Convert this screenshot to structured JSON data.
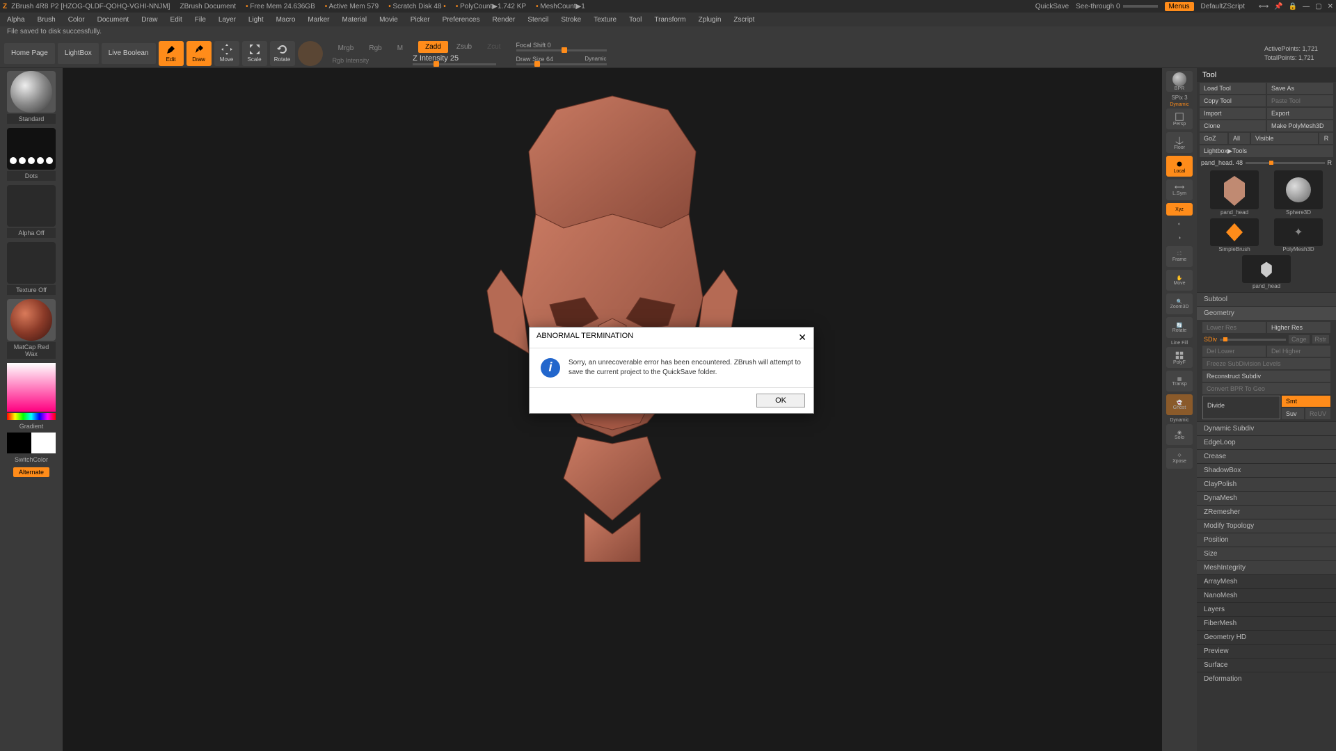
{
  "titlebar": {
    "app": "ZBrush 4R8 P2 [HZOG-QLDF-QOHQ-VGHI-NNJM]",
    "doc": "ZBrush Document",
    "freemem": "Free Mem 24.636GB",
    "activemem": "Active Mem 579",
    "scratch": "Scratch Disk 48",
    "polycount": "PolyCount▶1.742 KP",
    "meshcount": "MeshCount▶1",
    "quicksave": "QuickSave",
    "seethrough": "See-through  0",
    "menus": "Menus",
    "defaultzs": "DefaultZScript"
  },
  "menus": [
    "Alpha",
    "Brush",
    "Color",
    "Document",
    "Draw",
    "Edit",
    "File",
    "Layer",
    "Light",
    "Macro",
    "Marker",
    "Material",
    "Movie",
    "Picker",
    "Preferences",
    "Render",
    "Stencil",
    "Stroke",
    "Texture",
    "Tool",
    "Transform",
    "Zplugin",
    "Zscript"
  ],
  "status": "File saved to disk successfully.",
  "toolbar": {
    "home": "Home Page",
    "lightbox": "LightBox",
    "livebool": "Live Boolean",
    "edit": "Edit",
    "draw": "Draw",
    "move": "Move",
    "scale": "Scale",
    "rotate": "Rotate",
    "mrgb": "Mrgb",
    "rgb": "Rgb",
    "m": "M",
    "zadd": "Zadd",
    "zsub": "Zsub",
    "zcut": "Zcut",
    "rgbint": "Rgb Intensity",
    "zint": "Z Intensity 25",
    "focal": "Focal Shift 0",
    "drawsize": "Draw Size 64",
    "dynamic": "Dynamic",
    "active": "ActivePoints: 1,721",
    "total": "TotalPoints: 1,721"
  },
  "left": {
    "brush": "Standard",
    "stroke": "Dots",
    "alpha": "Alpha Off",
    "texture": "Texture Off",
    "material": "MatCap Red Wax",
    "gradient": "Gradient",
    "switch": "SwitchColor",
    "alternate": "Alternate"
  },
  "side": {
    "bpr": "BPR",
    "spix": "SPix 3",
    "persp": "Persp",
    "floor": "Floor",
    "local": "Local",
    "lsym": "L.Sym",
    "xyz": "Xyz",
    "frame": "Frame",
    "move": "Move",
    "zoom": "Zoom3D",
    "rotate": "Rotate",
    "linefill": "Line Fill",
    "polyf": "PolyF",
    "transp": "Transp",
    "ghost": "Ghost",
    "dynamic": "Dynamic",
    "solo": "Solo",
    "xpose": "Xpose"
  },
  "right": {
    "title": "Tool",
    "load": "Load Tool",
    "saveas": "Save As",
    "copy": "Copy Tool",
    "paste": "Paste Tool",
    "import": "Import",
    "export": "Export",
    "clone": "Clone",
    "makepoly": "Make PolyMesh3D",
    "goz": "GoZ",
    "all": "All",
    "visible": "Visible",
    "r": "R",
    "lightboxtools": "Lightbox▶Tools",
    "toolname": "pand_head. 48",
    "tools": [
      "pand_head",
      "Sphere3D",
      "PolyMesh3D",
      "pand_head",
      "SimpleBrush"
    ],
    "sects": [
      "Subtool",
      "Geometry",
      "Dynamic Subdiv",
      "EdgeLoop",
      "Crease",
      "ShadowBox",
      "ClayPolish",
      "DynaMesh",
      "ZRemesher",
      "Modify Topology",
      "Position",
      "Size",
      "MeshIntegrity",
      "ArrayMesh",
      "NanoMesh",
      "Layers",
      "FiberMesh",
      "Geometry HD",
      "Preview",
      "Surface",
      "Deformation"
    ],
    "geo": {
      "lower": "Lower Res",
      "higher": "Higher Res",
      "sdiv": "SDiv",
      "cage": "Cage",
      "rstr": "Rstr",
      "dellow": "Del Lower",
      "delhigh": "Del Higher",
      "freeze": "Freeze SubDivision Levels",
      "reconstruct": "Reconstruct Subdiv",
      "convertbpr": "Convert BPR To Geo",
      "divide": "Divide",
      "smt": "Smt",
      "suv": "Suv",
      "reuv": "ReUV"
    }
  },
  "dialog": {
    "title": "ABNORMAL TERMINATION",
    "msg": "Sorry, an unrecoverable error has been encountered. ZBrush will attempt to save the current project to the QuickSave folder.",
    "ok": "OK"
  }
}
